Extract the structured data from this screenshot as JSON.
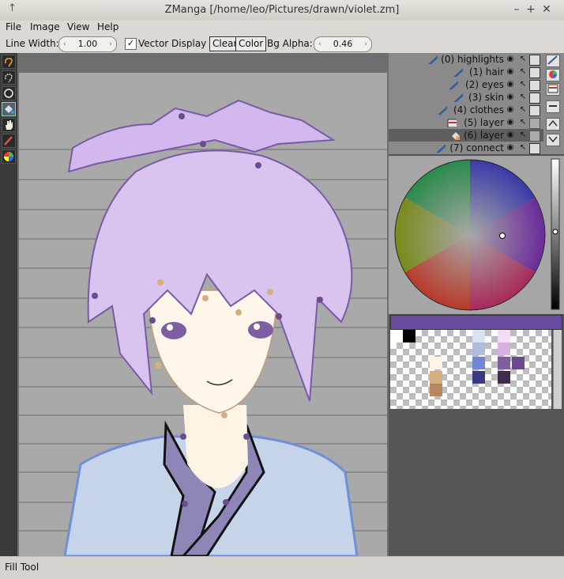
{
  "window": {
    "title": "ZManga [/home/leo/Pictures/drawn/violet.zm]"
  },
  "menu": [
    "File",
    "Image",
    "View",
    "Help"
  ],
  "toolbar": {
    "line_width_label": "Line Width:",
    "line_width_value": "1.00",
    "vector_display_label": "Vector Display",
    "vector_display_checked": true,
    "clear_label": "Clear",
    "color_label": "Color",
    "bg_alpha_label": "Bg Alpha:",
    "bg_alpha_value": "0.46"
  },
  "layers": [
    {
      "label": "(0) highlights",
      "icon": "brush-icon"
    },
    {
      "label": "(1) hair",
      "icon": "brush-icon"
    },
    {
      "label": "(2) eyes",
      "icon": "brush-icon"
    },
    {
      "label": "(3) skin",
      "icon": "brush-icon"
    },
    {
      "label": "(4) clothes",
      "icon": "brush-icon"
    },
    {
      "label": "(5) layer",
      "icon": "image-icon"
    },
    {
      "label": "(6) layer",
      "icon": "fill-icon",
      "selected": true
    },
    {
      "label": "(7) connect",
      "icon": "brush-icon"
    }
  ],
  "current_color": "#6a4ba0",
  "status": {
    "text": "Fill Tool"
  },
  "icons": {
    "minimize": "–",
    "maximize": "+",
    "close": "✕",
    "pin": "↑",
    "spin_left": "‹",
    "spin_right": "›",
    "check": "✓"
  }
}
